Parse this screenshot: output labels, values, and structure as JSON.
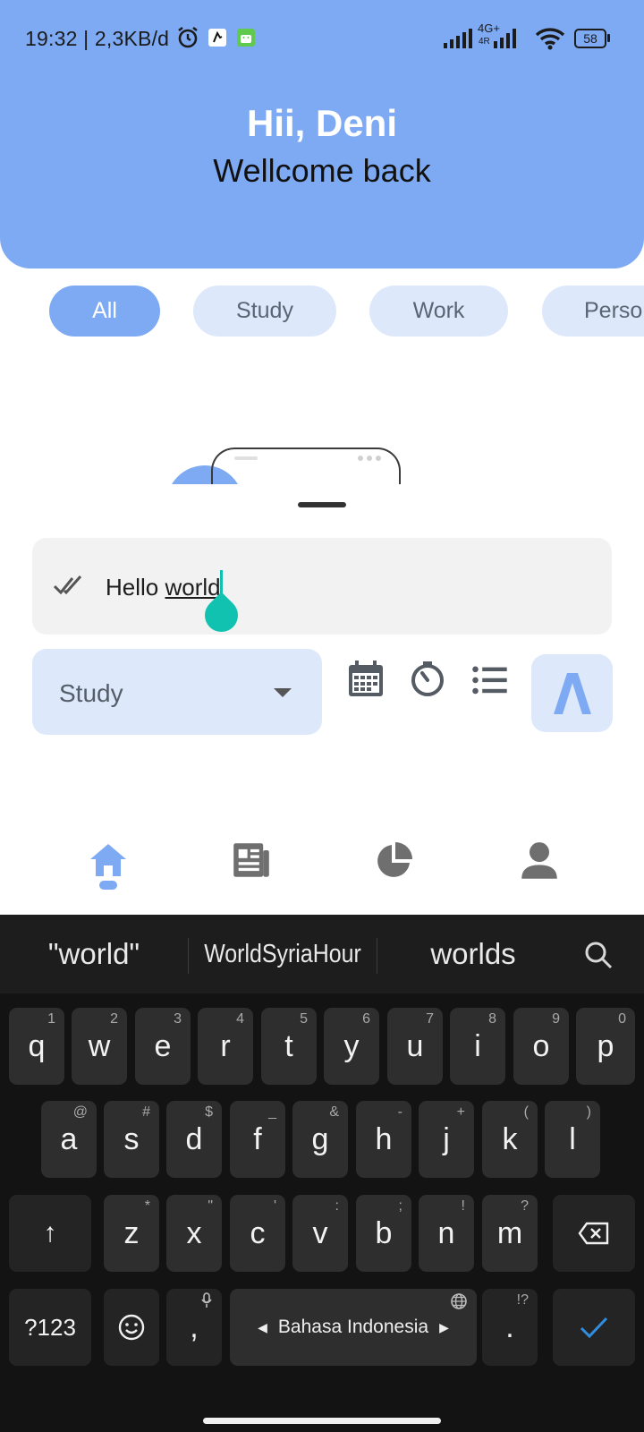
{
  "status_bar": {
    "text": "19:32 | 2,3KB/d",
    "network": "4G+",
    "network_sub": "4R",
    "battery": "58"
  },
  "header": {
    "greeting": "Hii, Deni",
    "subtitle": "Wellcome back",
    "accent_color": "#7eaaf3"
  },
  "chips": [
    {
      "label": "All",
      "active": true
    },
    {
      "label": "Study",
      "active": false
    },
    {
      "label": "Work",
      "active": false
    },
    {
      "label": "Perso",
      "active": false
    }
  ],
  "task_input": {
    "text_prefix": "Hello ",
    "text_underlined": "world"
  },
  "category_select": {
    "value": "Study"
  },
  "toolbar_icons": [
    "calendar-icon",
    "timer-icon",
    "list-icon"
  ],
  "send_icon": "send-arrow-icon",
  "bottom_nav": [
    {
      "icon": "home-icon",
      "active": true
    },
    {
      "icon": "newspaper-icon",
      "active": false
    },
    {
      "icon": "pie-chart-icon",
      "active": false
    },
    {
      "icon": "person-icon",
      "active": false
    }
  ],
  "keyboard": {
    "suggestions": [
      "\"world\"",
      "WorldSyriaHour",
      "worlds"
    ],
    "row1": [
      {
        "key": "q",
        "hint": "1"
      },
      {
        "key": "w",
        "hint": "2"
      },
      {
        "key": "e",
        "hint": "3"
      },
      {
        "key": "r",
        "hint": "4"
      },
      {
        "key": "t",
        "hint": "5"
      },
      {
        "key": "y",
        "hint": "6"
      },
      {
        "key": "u",
        "hint": "7"
      },
      {
        "key": "i",
        "hint": "8"
      },
      {
        "key": "o",
        "hint": "9"
      },
      {
        "key": "p",
        "hint": "0"
      }
    ],
    "row2": [
      {
        "key": "a",
        "hint": "@"
      },
      {
        "key": "s",
        "hint": "#"
      },
      {
        "key": "d",
        "hint": "$"
      },
      {
        "key": "f",
        "hint": "_"
      },
      {
        "key": "g",
        "hint": "&"
      },
      {
        "key": "h",
        "hint": "-"
      },
      {
        "key": "j",
        "hint": "+"
      },
      {
        "key": "k",
        "hint": "("
      },
      {
        "key": "l",
        "hint": ")"
      }
    ],
    "row3": [
      {
        "key": "z",
        "hint": "*"
      },
      {
        "key": "x",
        "hint": "\""
      },
      {
        "key": "c",
        "hint": "'"
      },
      {
        "key": "v",
        "hint": ":"
      },
      {
        "key": "b",
        "hint": ";"
      },
      {
        "key": "n",
        "hint": "!"
      },
      {
        "key": "m",
        "hint": "?"
      }
    ],
    "shift": "↑",
    "symbols": "?123",
    "comma": ",",
    "space_label": "Bahasa Indonesia",
    "period": ".",
    "period_hint": "!?",
    "enter_color": "#2f8ee0"
  }
}
